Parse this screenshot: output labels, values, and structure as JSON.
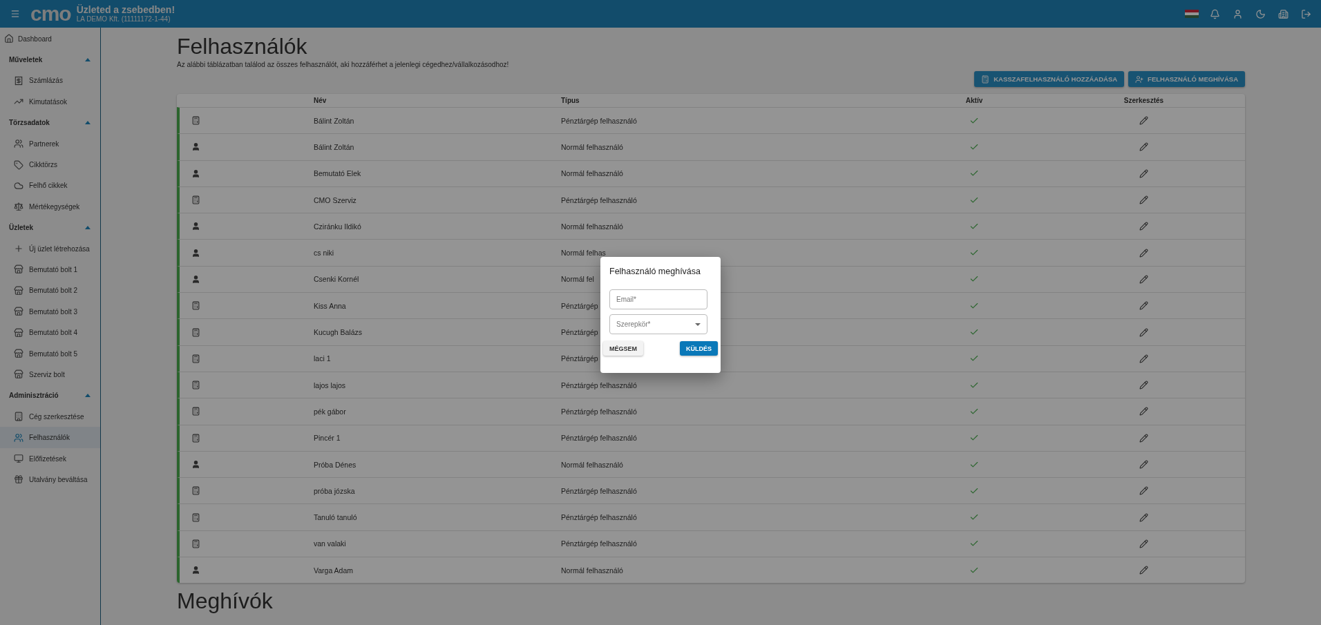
{
  "topbar": {
    "logo": "cmo",
    "title": "Üzleted a zsebedben!",
    "company": "LA DEMO Kft. (11111172-1-44)"
  },
  "sidebar": {
    "items": [
      {
        "kind": "link",
        "label": "Dashboard",
        "selected": false
      },
      {
        "kind": "section",
        "label": "Műveletek",
        "expanded": true,
        "children": [
          {
            "label": "Számlázás",
            "selected": false
          },
          {
            "label": "Kimutatások",
            "selected": false
          }
        ]
      },
      {
        "kind": "section",
        "label": "Törzsadatok",
        "expanded": true,
        "children": [
          {
            "label": "Partnerek",
            "selected": false
          },
          {
            "label": "Cikktörzs",
            "selected": false
          },
          {
            "label": "Felhő cikkek",
            "selected": false
          },
          {
            "label": "Mértékegységek",
            "selected": false
          }
        ]
      },
      {
        "kind": "section",
        "label": "Üzletek",
        "expanded": true,
        "children": [
          {
            "label": "Új üzlet létrehozása",
            "selected": false
          },
          {
            "label": "Bemutató bolt 1",
            "selected": false
          },
          {
            "label": "Bemutató bolt 2",
            "selected": false
          },
          {
            "label": "Bemutató bolt 3",
            "selected": false
          },
          {
            "label": "Bemutató bolt 4",
            "selected": false
          },
          {
            "label": "Bemutató bolt 5",
            "selected": false
          },
          {
            "label": "Szerviz bolt",
            "selected": false
          }
        ]
      },
      {
        "kind": "section",
        "label": "Adminisztráció",
        "expanded": true,
        "children": [
          {
            "label": "Cég szerkesztése",
            "selected": false
          },
          {
            "label": "Felhasználók",
            "selected": true
          },
          {
            "label": "Előfizetések",
            "selected": false
          },
          {
            "label": "Utalvány beváltása",
            "selected": false
          }
        ]
      }
    ]
  },
  "page": {
    "title": "Felhasználók",
    "subtitle": "Az alábbi táblázatban találod az összes felhasználót, aki hozzáférhet a jelenlegi cégedhez/vállalkozásodhoz!",
    "buttons": [
      {
        "kind": "cash",
        "label": "KASSZAFELHASZNÁLÓ HOZZÁADÁSA"
      },
      {
        "kind": "invite",
        "label": "FELHASZNÁLÓ MEGHÍVÁSA"
      }
    ],
    "next_title": "Meghívók"
  },
  "table": {
    "columns": [
      "Név",
      "Típus",
      "Aktív",
      "Szerkesztés"
    ],
    "rows": [
      {
        "kind": "cash",
        "name": "Bálint Zoltán",
        "type": "Pénztárgép felhasználó",
        "active": true
      },
      {
        "kind": "person",
        "name": "Bálint Zoltán",
        "type": "Normál felhasználó",
        "active": true
      },
      {
        "kind": "person",
        "name": "Bemutató Elek",
        "type": "Normál felhasználó",
        "active": true
      },
      {
        "kind": "cash",
        "name": "CMO Szerviz",
        "type": "Pénztárgép felhasználó",
        "active": true
      },
      {
        "kind": "person",
        "name": "Cziránku Ildikó",
        "type": "Normál felhasználó",
        "active": true
      },
      {
        "kind": "person",
        "name": "cs niki",
        "type": "Normál felhas",
        "active": true
      },
      {
        "kind": "person",
        "name": "Csenki Kornél",
        "type": "Normál fel",
        "active": true
      },
      {
        "kind": "cash",
        "name": "Kiss Anna",
        "type": "Pénztárgép",
        "active": true
      },
      {
        "kind": "cash",
        "name": "Kucugh Balázs",
        "type": "Pénztárgép",
        "active": true
      },
      {
        "kind": "cash",
        "name": "laci 1",
        "type": "Pénztárgép",
        "active": true
      },
      {
        "kind": "cash",
        "name": "lajos lajos",
        "type": "Pénztárgép felhasználó",
        "active": true
      },
      {
        "kind": "cash",
        "name": "pék gábor",
        "type": "Pénztárgép felhasználó",
        "active": true
      },
      {
        "kind": "cash",
        "name": "Pincér 1",
        "type": "Pénztárgép felhasználó",
        "active": true
      },
      {
        "kind": "person",
        "name": "Próba Dénes",
        "type": "Normál felhasználó",
        "active": true
      },
      {
        "kind": "cash",
        "name": "próba józska",
        "type": "Pénztárgép felhasználó",
        "active": true
      },
      {
        "kind": "cash",
        "name": "Tanuló tanuló",
        "type": "Pénztárgép felhasználó",
        "active": true
      },
      {
        "kind": "cash",
        "name": "van valaki",
        "type": "Pénztárgép felhasználó",
        "active": true
      },
      {
        "kind": "person",
        "name": "Varga Adam",
        "type": "Normál felhasználó",
        "active": true
      }
    ]
  },
  "dialog": {
    "title": "Felhasználó meghívása",
    "email": {
      "placeholder": "Email*"
    },
    "role": {
      "placeholder": "Szerepkör*"
    },
    "cancel": "MÉGSEM",
    "submit": "KÜLDÉS"
  }
}
